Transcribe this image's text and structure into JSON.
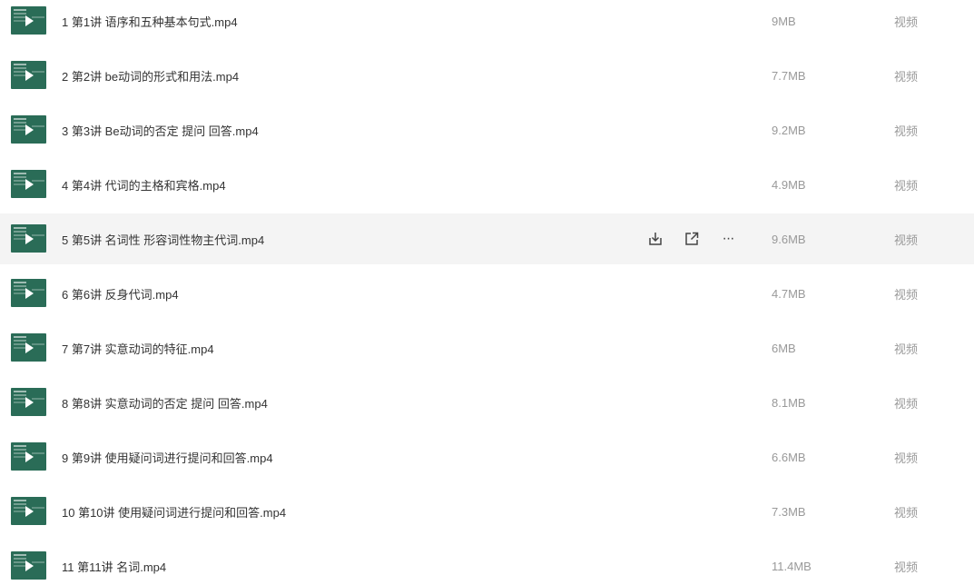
{
  "files": [
    {
      "name": "1 第1讲 语序和五种基本句式.mp4",
      "size": "9MB",
      "type": "视频"
    },
    {
      "name": "2 第2讲 be动词的形式和用法.mp4",
      "size": "7.7MB",
      "type": "视频"
    },
    {
      "name": "3 第3讲 Be动词的否定 提问 回答.mp4",
      "size": "9.2MB",
      "type": "视频"
    },
    {
      "name": "4 第4讲 代词的主格和宾格.mp4",
      "size": "4.9MB",
      "type": "视频"
    },
    {
      "name": "5 第5讲 名词性 形容词性物主代词.mp4",
      "size": "9.6MB",
      "type": "视频"
    },
    {
      "name": "6 第6讲 反身代词.mp4",
      "size": "4.7MB",
      "type": "视频"
    },
    {
      "name": "7 第7讲 实意动词的特征.mp4",
      "size": "6MB",
      "type": "视频"
    },
    {
      "name": "8 第8讲 实意动词的否定 提问 回答.mp4",
      "size": "8.1MB",
      "type": "视频"
    },
    {
      "name": "9 第9讲 使用疑问词进行提问和回答.mp4",
      "size": "6.6MB",
      "type": "视频"
    },
    {
      "name": "10 第10讲 使用疑问词进行提问和回答.mp4",
      "size": "7.3MB",
      "type": "视频"
    },
    {
      "name": "11 第11讲 名词.mp4",
      "size": "11.4MB",
      "type": "视频"
    }
  ],
  "hovered_index": 4,
  "row_actions": {
    "download_icon": "download-icon",
    "share_icon": "share-icon",
    "more_icon": "more-icon",
    "more_glyph": "···"
  },
  "colors": {
    "thumbnail": "#2a6c57",
    "hover_row": "#f4f4f4"
  }
}
